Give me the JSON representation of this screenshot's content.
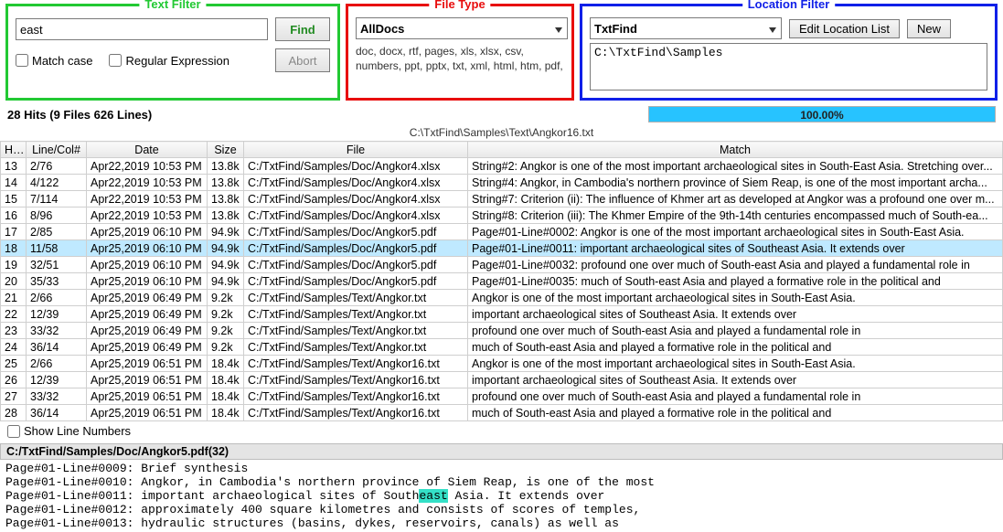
{
  "textFilter": {
    "legend": "Text Filter",
    "value": "east",
    "findLabel": "Find",
    "abortLabel": "Abort",
    "matchCaseLabel": "Match case",
    "regexLabel": "Regular Expression"
  },
  "fileType": {
    "legend": "File Type",
    "selected": "AllDocs",
    "desc": "doc, docx, rtf, pages, xls, xlsx, csv, numbers, ppt, pptx, txt, xml, html, htm, pdf,"
  },
  "location": {
    "legend": "Location Filter",
    "selected": "TxtFind",
    "editLabel": "Edit Location List",
    "newLabel": "New",
    "path": "C:\\TxtFind\\Samples"
  },
  "status": {
    "hits": "28 Hits   (9 Files 626 Lines)",
    "progress": "100.00%",
    "currentFile": "C:\\TxtFind\\Samples\\Text\\Angkor16.txt"
  },
  "headers": {
    "hit": "Hit#",
    "lc": "Line/Col#",
    "date": "Date",
    "size": "Size",
    "file": "File",
    "match": "Match"
  },
  "rows": [
    {
      "hit": "13",
      "lc": "2/76",
      "date": "Apr22,2019 10:53 PM",
      "size": "13.8k",
      "file": "C:/TxtFind/Samples/Doc/Angkor4.xlsx",
      "match": "String#2: Angkor is one of the most important archaeological sites in South-East Asia. Stretching over..."
    },
    {
      "hit": "14",
      "lc": "4/122",
      "date": "Apr22,2019 10:53 PM",
      "size": "13.8k",
      "file": "C:/TxtFind/Samples/Doc/Angkor4.xlsx",
      "match": "String#4: Angkor, in Cambodia's northern province of Siem Reap, is one of the most important archa..."
    },
    {
      "hit": "15",
      "lc": "7/114",
      "date": "Apr22,2019 10:53 PM",
      "size": "13.8k",
      "file": "C:/TxtFind/Samples/Doc/Angkor4.xlsx",
      "match": "String#7: Criterion (ii): The influence of Khmer art as developed at Angkor was a profound one over m..."
    },
    {
      "hit": "16",
      "lc": "8/96",
      "date": "Apr22,2019 10:53 PM",
      "size": "13.8k",
      "file": "C:/TxtFind/Samples/Doc/Angkor4.xlsx",
      "match": "String#8: Criterion (iii): The Khmer Empire of the 9th-14th centuries encompassed much of South-ea..."
    },
    {
      "hit": "17",
      "lc": "2/85",
      "date": "Apr25,2019 06:10 PM",
      "size": "94.9k",
      "file": "C:/TxtFind/Samples/Doc/Angkor5.pdf",
      "match": "Page#01-Line#0002: Angkor is one of the most important archaeological sites in South-East Asia."
    },
    {
      "hit": "18",
      "lc": "11/58",
      "date": "Apr25,2019 06:10 PM",
      "size": "94.9k",
      "file": "C:/TxtFind/Samples/Doc/Angkor5.pdf",
      "match": "Page#01-Line#0011: important archaeological sites of Southeast Asia. It extends over",
      "sel": true
    },
    {
      "hit": "19",
      "lc": "32/51",
      "date": "Apr25,2019 06:10 PM",
      "size": "94.9k",
      "file": "C:/TxtFind/Samples/Doc/Angkor5.pdf",
      "match": "Page#01-Line#0032: profound one over much of South-east Asia and played a fundamental role in"
    },
    {
      "hit": "20",
      "lc": "35/33",
      "date": "Apr25,2019 06:10 PM",
      "size": "94.9k",
      "file": "C:/TxtFind/Samples/Doc/Angkor5.pdf",
      "match": "Page#01-Line#0035: much of South-east Asia and played a formative role in the political and"
    },
    {
      "hit": "21",
      "lc": "2/66",
      "date": "Apr25,2019 06:49 PM",
      "size": "9.2k",
      "file": "C:/TxtFind/Samples/Text/Angkor.txt",
      "match": "Angkor is one of the most important archaeological sites in South-East Asia."
    },
    {
      "hit": "22",
      "lc": "12/39",
      "date": "Apr25,2019 06:49 PM",
      "size": "9.2k",
      "file": "C:/TxtFind/Samples/Text/Angkor.txt",
      "match": "important archaeological sites of Southeast Asia. It extends over"
    },
    {
      "hit": "23",
      "lc": "33/32",
      "date": "Apr25,2019 06:49 PM",
      "size": "9.2k",
      "file": "C:/TxtFind/Samples/Text/Angkor.txt",
      "match": "profound one over much of South-east Asia and played a fundamental role in"
    },
    {
      "hit": "24",
      "lc": "36/14",
      "date": "Apr25,2019 06:49 PM",
      "size": "9.2k",
      "file": "C:/TxtFind/Samples/Text/Angkor.txt",
      "match": "much of South-east Asia and played a formative role in the political and"
    },
    {
      "hit": "25",
      "lc": "2/66",
      "date": "Apr25,2019 06:51 PM",
      "size": "18.4k",
      "file": "C:/TxtFind/Samples/Text/Angkor16.txt",
      "match": "Angkor is one of the most important archaeological sites in South-East Asia."
    },
    {
      "hit": "26",
      "lc": "12/39",
      "date": "Apr25,2019 06:51 PM",
      "size": "18.4k",
      "file": "C:/TxtFind/Samples/Text/Angkor16.txt",
      "match": "important archaeological sites of Southeast Asia. It extends over"
    },
    {
      "hit": "27",
      "lc": "33/32",
      "date": "Apr25,2019 06:51 PM",
      "size": "18.4k",
      "file": "C:/TxtFind/Samples/Text/Angkor16.txt",
      "match": "profound one over much of South-east Asia and played a fundamental role in"
    },
    {
      "hit": "28",
      "lc": "36/14",
      "date": "Apr25,2019 06:51 PM",
      "size": "18.4k",
      "file": "C:/TxtFind/Samples/Text/Angkor16.txt",
      "match": "much of South-east Asia and played a formative role in the political and"
    }
  ],
  "showLineNumbersLabel": "Show Line Numbers",
  "preview": {
    "file": "C:/TxtFind/Samples/Doc/Angkor5.pdf(32)",
    "lines": [
      "Page#01-Line#0009: Brief synthesis",
      "Page#01-Line#0010: Angkor, in Cambodia's northern province of Siem Reap, is one of the most",
      "Page#01-Line#0011: important archaeological sites of South<hl>east</hl> Asia. It extends over",
      "Page#01-Line#0012: approximately 400 square kilometres and consists of scores of temples,",
      "Page#01-Line#0013: hydraulic structures (basins, dykes, reservoirs, canals) as well as"
    ]
  }
}
